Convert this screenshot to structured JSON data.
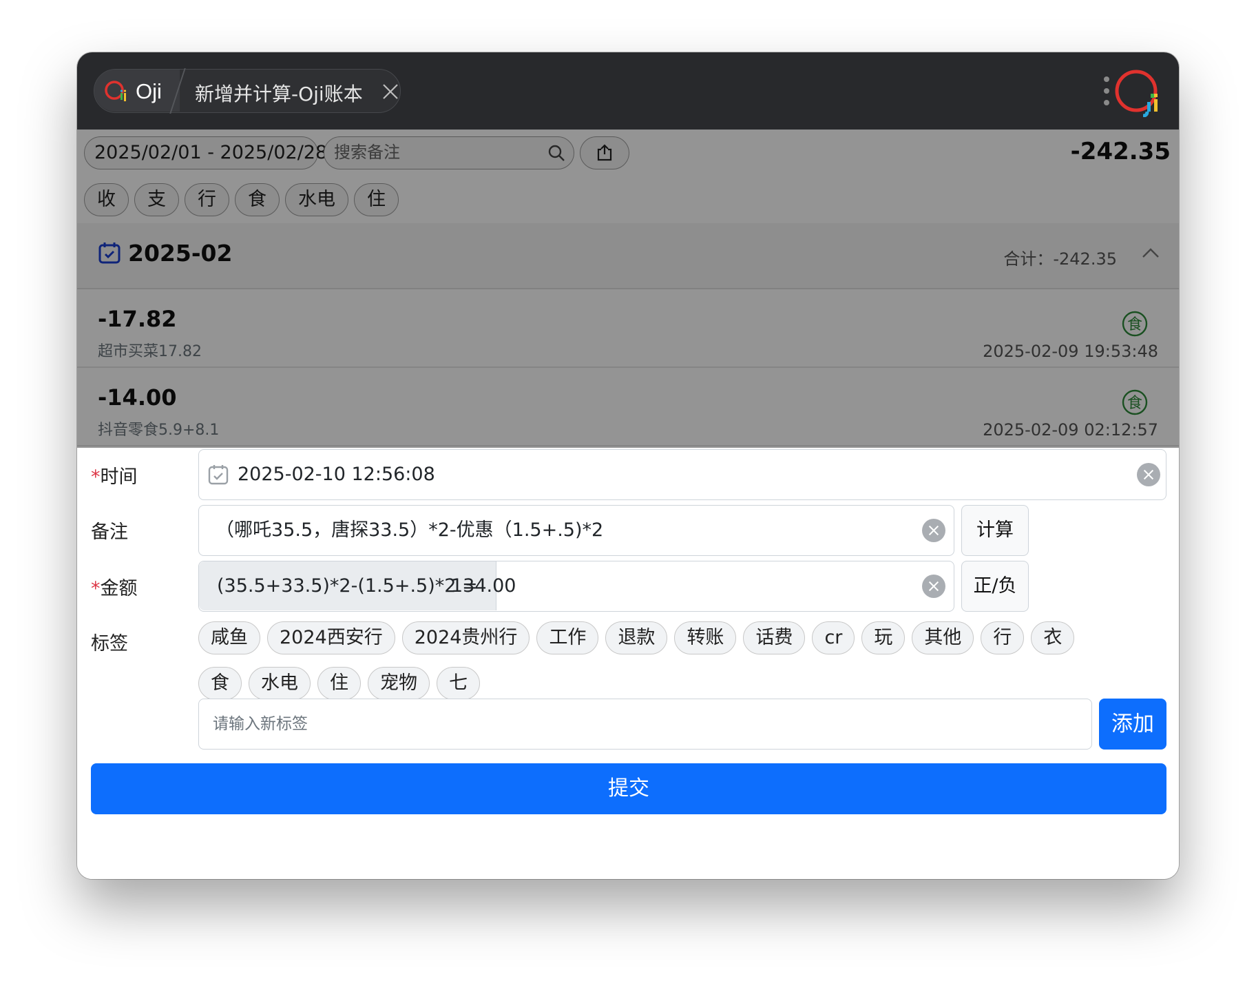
{
  "titlebar": {
    "app_name": "Oji",
    "tab_title": "新增并计算-Oji账本"
  },
  "list": {
    "date_range": "2025/02/01 - 2025/02/28",
    "search_placeholder": "搜索备注",
    "total": "-242.35",
    "filters": [
      "收",
      "支",
      "行",
      "食",
      "水电",
      "住"
    ],
    "month": "2025-02",
    "month_sum": "合计：-242.35",
    "entries": [
      {
        "amount": "-17.82",
        "memo": "超市买菜17.82",
        "tag_icon": "食",
        "time": "2025-02-09 19:53:48"
      },
      {
        "amount": "-14.00",
        "memo": "抖音零食5.9+8.1",
        "tag_icon": "食",
        "time": "2025-02-09 02:12:57"
      }
    ]
  },
  "form": {
    "time_label": "时间",
    "time_value": "2025-02-10 12:56:08",
    "memo_label": "备注",
    "memo_value": "（哪吒35.5，唐探33.5）*2-优惠（1.5+.5)*2",
    "calc_button": "计算",
    "amount_label": "金额",
    "amount_expression": "(35.5+33.5)*2-(1.5+.5)*2 =",
    "amount_value": "134.00",
    "sign_button": "正/负",
    "tags_label": "标签",
    "tags": [
      "咸鱼",
      "2024西安行",
      "2024贵州行",
      "工作",
      "退款",
      "转账",
      "话费",
      "cr",
      "玩",
      "其他",
      "行",
      "衣",
      "食",
      "水电",
      "住",
      "宠物",
      "七"
    ],
    "new_tag_placeholder": "请输入新标签",
    "add_button": "添加",
    "submit_button": "提交"
  },
  "colors": {
    "primary": "#0d6efd",
    "required": "#dc3545",
    "food_tag": "#2e8b3a"
  }
}
